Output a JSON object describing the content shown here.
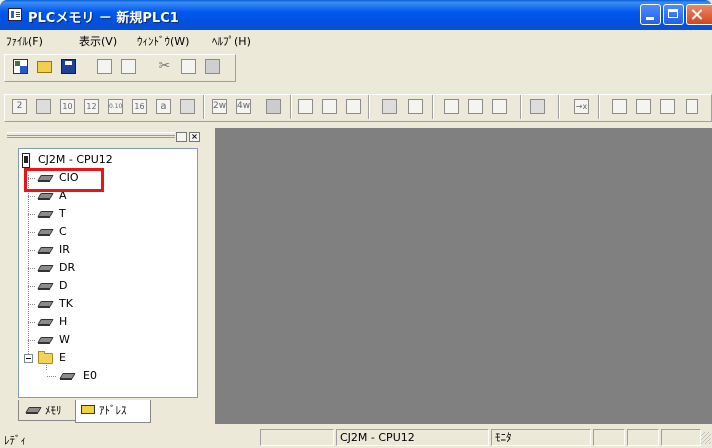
{
  "window": {
    "title": "PLCメモリ － 新規PLC1",
    "title_icon": "plc-memory-app-icon",
    "controls": [
      "minimize-icon",
      "maximize-icon",
      "close-icon"
    ],
    "accent": "#0054e3"
  },
  "menu": {
    "file": "ﾌｧｲﾙ(F)",
    "view": "表示(V)",
    "window": "ｳｨﾝﾄﾞｳ(W)",
    "help": "ﾍﾙﾌﾟ(H)"
  },
  "toolbar1": {
    "icons": [
      "new-icon",
      "open-icon",
      "save-icon",
      "print-icon",
      "print-preview-icon",
      "cut-icon",
      "copy-icon",
      "paste-icon"
    ]
  },
  "toolbar2": {
    "glyphs": {
      "b1": "2",
      "b3": "10",
      "b4": "12",
      "b5": "0.10",
      "b6": "16",
      "b7": "a",
      "b8": "2w",
      "b9": "4w",
      "b10": "→x"
    }
  },
  "tree": {
    "root": "CJ2M - CPU12",
    "items": [
      "CIO",
      "A",
      "T",
      "C",
      "IR",
      "DR",
      "D",
      "TK",
      "H",
      "W"
    ],
    "folder": "E",
    "folder_child": "E0"
  },
  "tabs": {
    "memory": "ﾒﾓﾘ",
    "address": "ｱﾄﾞﾚｽ"
  },
  "status": {
    "left": "ﾚﾃﾞｨ",
    "device": "CJ2M - CPU12",
    "mode": "ﾓﾆﾀ"
  },
  "highlight_color": "#e8141a"
}
